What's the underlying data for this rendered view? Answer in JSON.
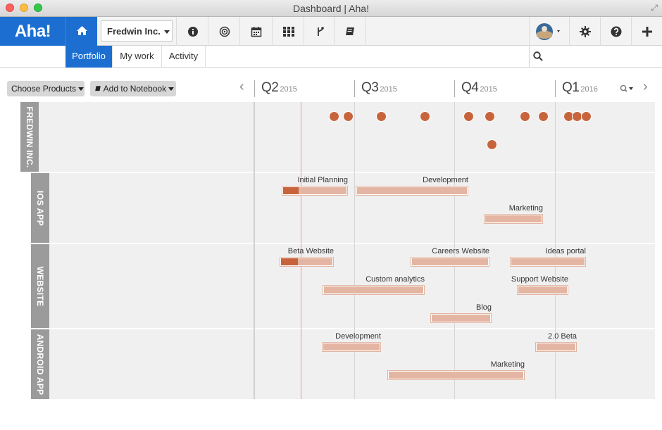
{
  "window": {
    "title": "Dashboard | Aha!"
  },
  "nav": {
    "logo": "Aha!",
    "product": "Fredwin Inc.",
    "icons": [
      "home-icon",
      "info-icon",
      "target-icon",
      "calendar-icon",
      "grid-icon",
      "branch-icon",
      "notebook-icon",
      "avatar",
      "gear-icon",
      "help-icon",
      "plus-icon"
    ]
  },
  "subnav": {
    "tabs": [
      "Portfolio",
      "My work",
      "Activity"
    ],
    "active": "Portfolio",
    "search_placeholder": ""
  },
  "toolbar": {
    "choose_products": "Choose Products",
    "add_to_notebook": "Add to Notebook"
  },
  "timeline": {
    "quarters": [
      {
        "q": "Q2",
        "year": "2015"
      },
      {
        "q": "Q3",
        "year": "2015"
      },
      {
        "q": "Q4",
        "year": "2015"
      },
      {
        "q": "Q1",
        "year": "2016"
      }
    ]
  },
  "rows": [
    {
      "label": "FREDWIN INC."
    },
    {
      "label": "IOS APP"
    },
    {
      "label": "WEBSITE"
    },
    {
      "label": "ANDROID APP"
    }
  ],
  "releases": {
    "ios": [
      "Initial Planning",
      "Development",
      "Marketing"
    ],
    "website": [
      "Beta Website",
      "Careers Website",
      "Ideas portal",
      "Custom analytics",
      "Support Website",
      "Blog"
    ],
    "android": [
      "Development",
      "2.0 Beta",
      "Marketing"
    ]
  },
  "colors": {
    "brand": "#1c6fd0",
    "milestone": "#c8643c",
    "release_bar": "#e3b5a2",
    "today_line": "#e89a8a"
  }
}
